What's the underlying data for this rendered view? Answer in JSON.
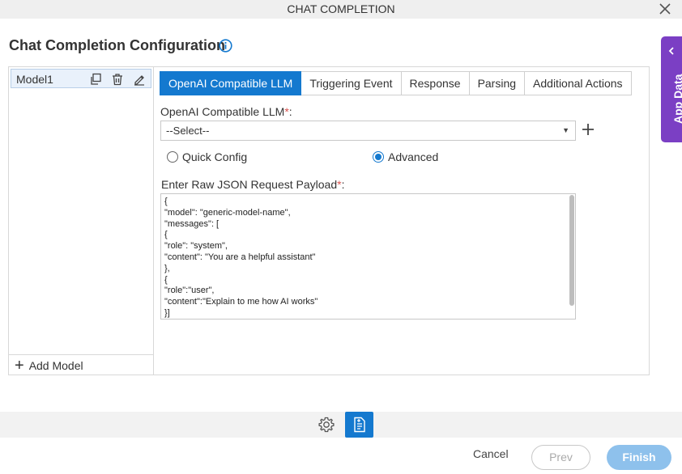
{
  "window": {
    "title": "CHAT COMPLETION"
  },
  "page": {
    "title": "Chat Completion Configuration"
  },
  "models": {
    "items": [
      {
        "label": "Model1"
      }
    ],
    "add_label": "Add Model"
  },
  "tabs": [
    {
      "label": "OpenAI Compatible LLM",
      "active": true
    },
    {
      "label": "Triggering Event",
      "active": false
    },
    {
      "label": "Response",
      "active": false
    },
    {
      "label": "Parsing",
      "active": false
    },
    {
      "label": "Additional Actions",
      "active": false
    }
  ],
  "form": {
    "llm_label": "OpenAI Compatible LLM",
    "required_mark": "*",
    "colon": ":",
    "llm_select_value": "--Select--",
    "config_options": [
      {
        "label": "Quick Config",
        "selected": false
      },
      {
        "label": "Advanced",
        "selected": true
      }
    ],
    "payload_label": "Enter Raw JSON Request Payload",
    "payload_lines": [
      "{",
      "\"model\": \"generic-model-name\",",
      "\"messages\": [",
      "{",
      "\"role\": \"system\",",
      "\"content\": \"You are a helpful assistant\"",
      "},",
      "{",
      "\"role\":\"user\",",
      "\"content\":\"Explain to me how AI works\"",
      "}]"
    ]
  },
  "side_panel": {
    "label": "App Data"
  },
  "footer": {
    "cancel": "Cancel",
    "prev": "Prev",
    "finish": "Finish"
  },
  "colors": {
    "accent": "#1479cf",
    "app_data": "#7b3fc4",
    "finish_disabled": "#8ec1ec",
    "required": "#d9534f"
  }
}
